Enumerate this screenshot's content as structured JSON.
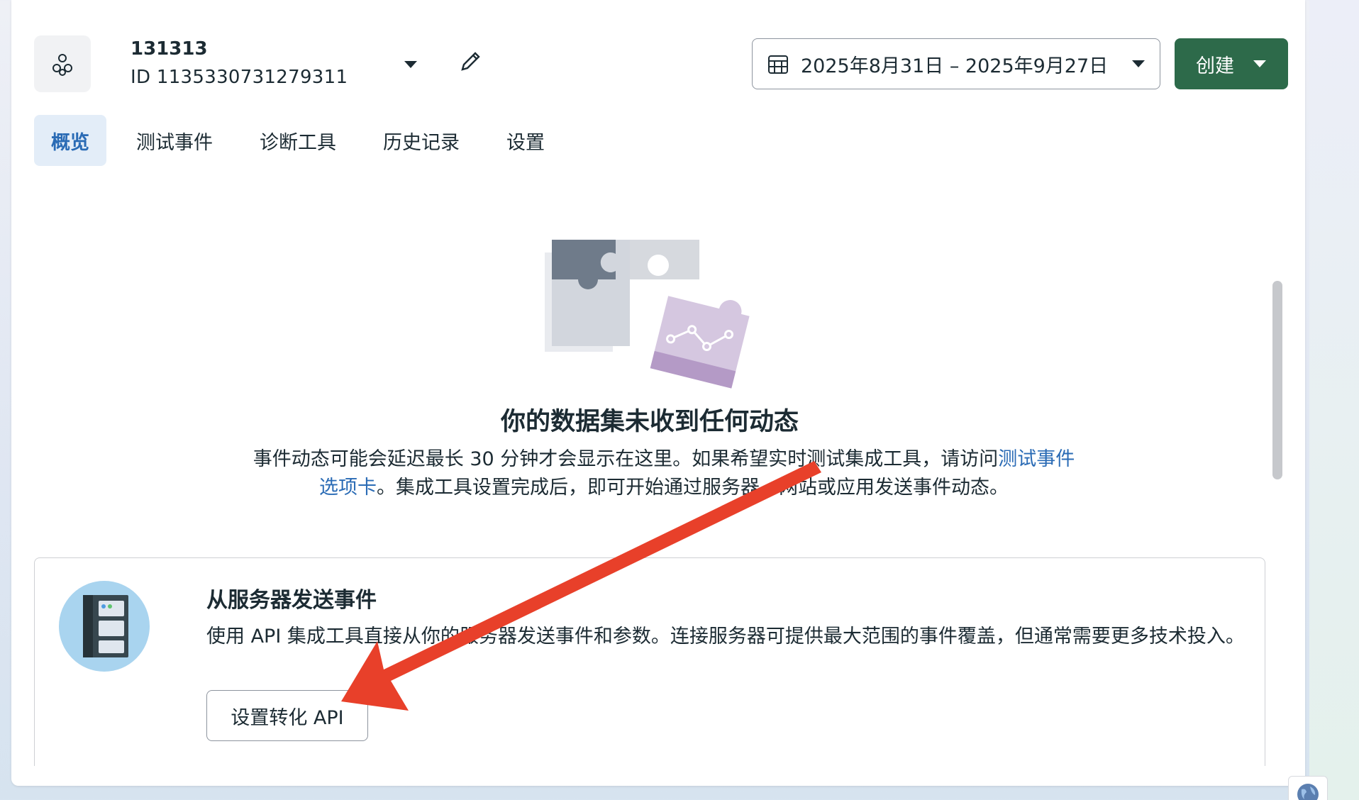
{
  "dataset": {
    "name": "131313",
    "id": "ID 1135330731279311"
  },
  "date_range": "2025年8月31日 – 2025年9月27日",
  "create_label": "创建",
  "tabs": [
    "概览",
    "测试事件",
    "诊断工具",
    "历史记录",
    "设置"
  ],
  "active_tab": "概览",
  "empty_state": {
    "title": "你的数据集未收到任何动态",
    "desc_before": "事件动态可能会延迟最长 30 分钟才会显示在这里。如果希望实时测试集成工具，请访问",
    "desc_link": "测试事件选项卡",
    "desc_after": "。集成工具设置完成后，即可开始通过服务器、网站或应用发送事件动态。"
  },
  "server_card": {
    "title": "从服务器发送事件",
    "description": "使用 API 集成工具直接从你的服务器发送事件和参数。连接服务器可提供最大范围的事件覆盖，但通常需要更多技术投入。",
    "button_label": "设置转化 API"
  },
  "icons": [
    "dataset-icon",
    "caret-down-icon",
    "pencil-icon",
    "calendar-icon",
    "server-icon",
    "globe-icon"
  ],
  "colors": {
    "primary": "#2d6a4a",
    "link": "#2a6bb5",
    "active_tab_bg": "#e3edf8",
    "annotation_arrow": "#e8402a"
  }
}
